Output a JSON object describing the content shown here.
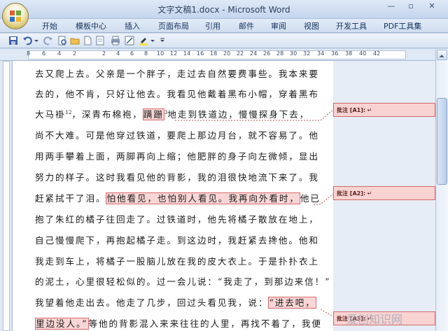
{
  "window": {
    "title": "文字文稿1.docx - Microsoft Word",
    "minimize": "—",
    "maximize": "▫",
    "close": "✕"
  },
  "menu": {
    "items": [
      "开始",
      "模板中心",
      "插入",
      "页面布局",
      "引用",
      "邮件",
      "审阅",
      "视图",
      "开发工具",
      "PDF工具集"
    ]
  },
  "ruler": {
    "ticks": [
      "8",
      "6",
      "4",
      "2",
      "",
      "2",
      "4",
      "6",
      "8",
      "10",
      "12",
      "14",
      "16",
      "18",
      "20",
      "22",
      "24",
      "26",
      "28",
      "30",
      "32",
      "34",
      "36",
      "38",
      "40",
      "42"
    ]
  },
  "document": {
    "lines": [
      "去又爬上去。父亲是一个胖子，走过去自然要费事些。我本来要",
      "去的，他不肯，只好让他去。我看见他戴着黑布小帽，穿着黑布",
      [
        "大马褂",
        "12",
        "，深青布棉袍，",
        "蹒跚",
        "3",
        "地走到铁道边，慢慢探身下去，"
      ],
      "尚不大难。可是他穿过铁道，要爬上那边月台，就不容易了。他",
      "用两手攀着上面，两脚再向上缩；他肥胖的身子向左微倾，显出",
      "努力的样子。这时我看见他的背影，我的泪很快地流下来了。我",
      [
        "赶紧拭干了泪。",
        "怕他看见，也怕别人看见。我再向外看时，",
        "他已"
      ],
      "抱了朱红的橘子往回走了。过铁道时，他先将橘子散放在地上，",
      "自己慢慢爬下，再抱起橘子走。到这边时，我赶紧去搀他。他和",
      "我走到车上，将橘子一股脑儿放在我的皮大衣上。于是扑扑衣上",
      "的泥土，心里很轻松似的。过一会儿说：“我走了，到那边来信！”",
      [
        "我望着他走出去。他走了几步，回过头看见我，说：",
        "“进去吧，"
      ],
      [
        "里边没人。”",
        "等他的背影混入来来往往的人里，再找不着了，我便"
      ]
    ]
  },
  "comments": [
    {
      "label": "批注 [A1]:",
      "mark": "↵"
    },
    {
      "label": "批注 [A2]:",
      "mark": "↵"
    },
    {
      "label": "批注 [A3]:",
      "mark": "↵"
    }
  ],
  "watermark": "爱刨知识网"
}
